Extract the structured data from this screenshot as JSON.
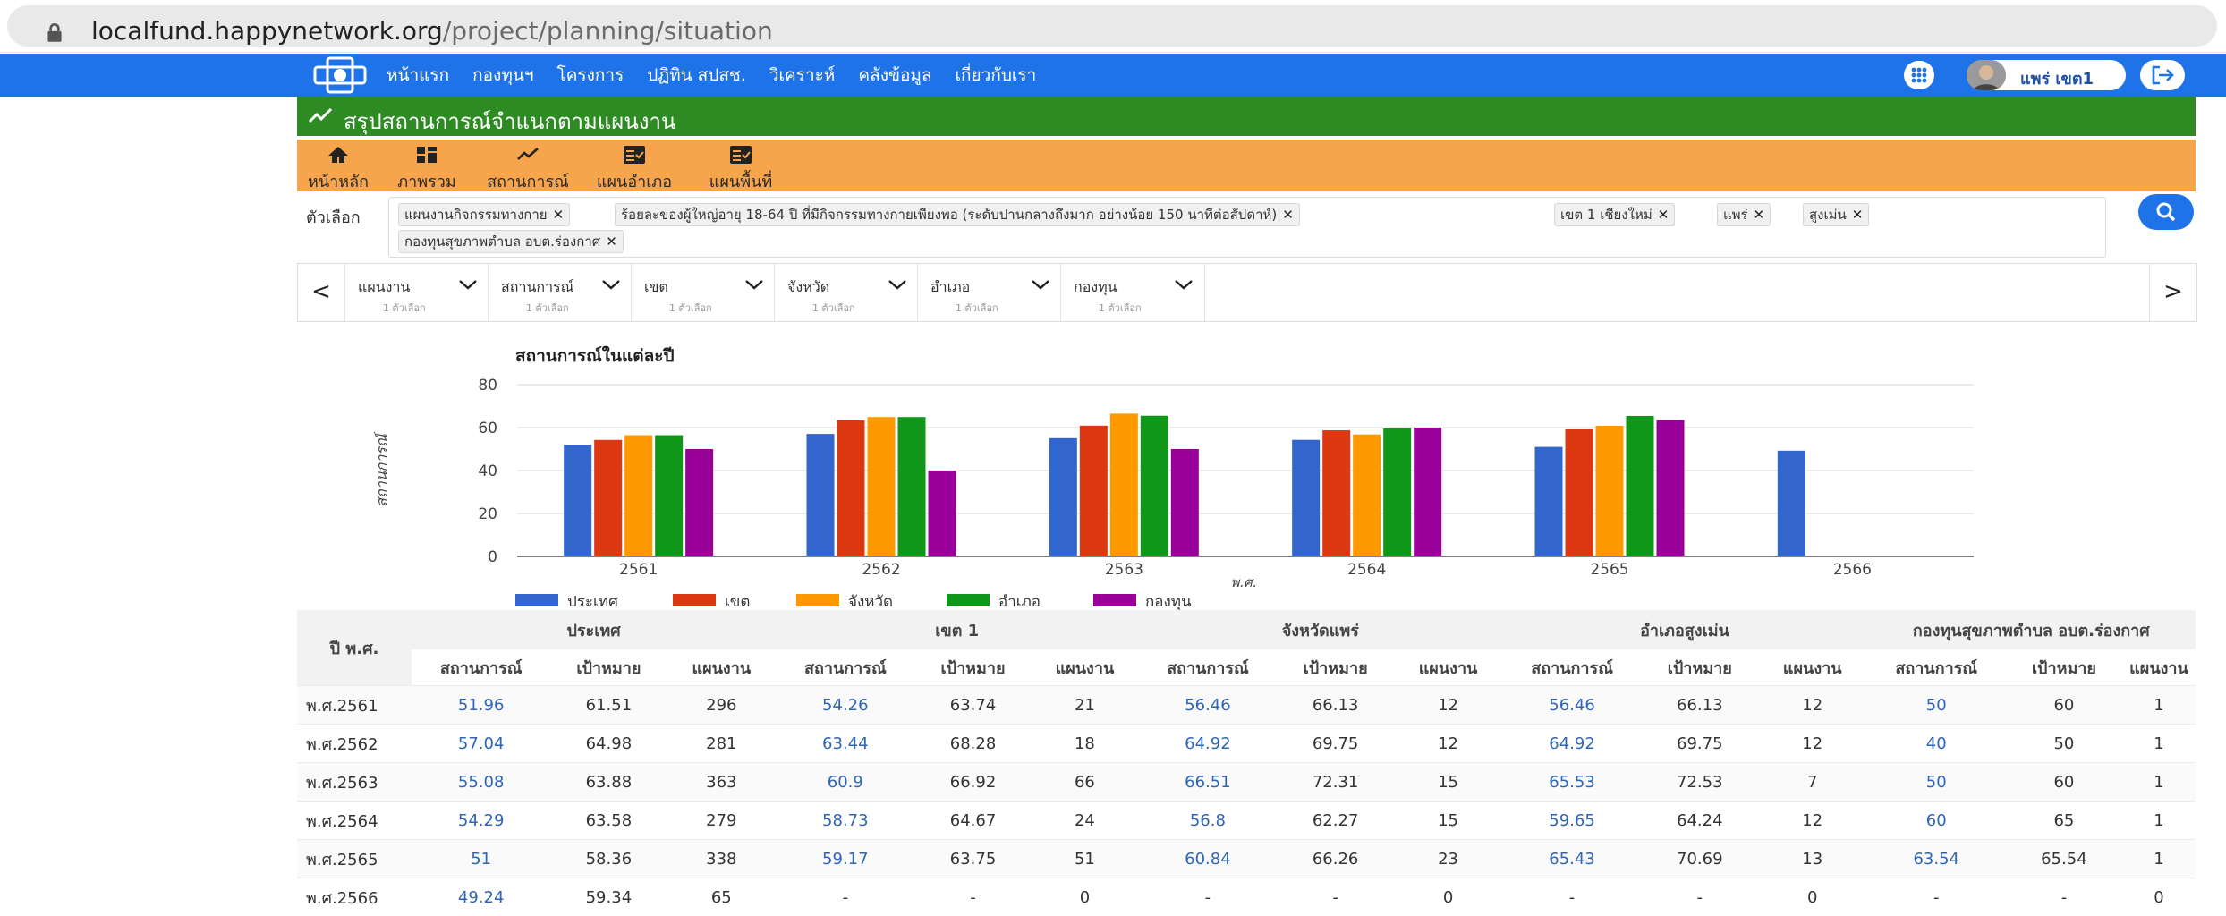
{
  "browser": {
    "url_domain": "localfund.happynetwork.org",
    "url_path": "/project/planning/situation"
  },
  "nav": {
    "items": [
      "หน้าแรก",
      "กองทุนฯ",
      "โครงการ",
      "ปฏิทิน สปสช.",
      "วิเคราะห์",
      "คลังข้อมูล",
      "เกี่ยวกับเรา"
    ],
    "user_name": "แพร่ เขต1"
  },
  "page": {
    "title": "สรุปสถานการณ์จำแนกตามแผนงาน"
  },
  "toolbar": {
    "buttons": [
      "หน้าหลัก",
      "ภาพรวม",
      "สถานการณ์",
      "แผนอำเภอ",
      "แผนพื้นที่"
    ]
  },
  "filters": {
    "label": "ตัวเลือก",
    "chips": [
      "แผนงานกิจกรรมทางกาย",
      "ร้อยละของผู้ใหญ่อายุ 18-64 ปี ที่มีกิจกรรมทางกายเพียงพอ (ระดับปานกลางถึงมาก อย่างน้อย 150 นาทีต่อสัปดาห์)",
      "เขต 1 เชียงใหม่",
      "แพร่",
      "สูงเม่น",
      "กองทุนสุขภาพตำบล อบต.ร่องกาศ"
    ]
  },
  "selectors": {
    "prev": "<",
    "next": ">",
    "items": [
      {
        "name": "แผนงาน",
        "sub": "1 ตัวเลือก"
      },
      {
        "name": "สถานการณ์",
        "sub": "1 ตัวเลือก"
      },
      {
        "name": "เขต",
        "sub": "1 ตัวเลือก"
      },
      {
        "name": "จังหวัด",
        "sub": "1 ตัวเลือก"
      },
      {
        "name": "อำเภอ",
        "sub": "1 ตัวเลือก"
      },
      {
        "name": "กองทุน",
        "sub": "1 ตัวเลือก"
      }
    ]
  },
  "chart_data": {
    "type": "bar",
    "title": "สถานการณ์ในแต่ละปี",
    "xlabel": "พ.ศ.",
    "ylabel": "สถานการณ์",
    "ylim": [
      0,
      80
    ],
    "yticks": [
      0,
      20,
      40,
      60,
      80
    ],
    "grid": true,
    "legend": "bottom-left",
    "categories": [
      "2561",
      "2562",
      "2563",
      "2564",
      "2565",
      "2566"
    ],
    "series": [
      {
        "name": "ประเทศ",
        "color": "#3366cc",
        "values": [
          51.96,
          57.04,
          55.08,
          54.29,
          51,
          49.24
        ]
      },
      {
        "name": "เขต",
        "color": "#dc3912",
        "values": [
          54.26,
          63.44,
          60.9,
          58.73,
          59.17,
          null
        ]
      },
      {
        "name": "จังหวัด",
        "color": "#ff9900",
        "values": [
          56.46,
          64.92,
          66.51,
          56.8,
          60.84,
          null
        ]
      },
      {
        "name": "อำเภอ",
        "color": "#109618",
        "values": [
          56.46,
          64.92,
          65.53,
          59.65,
          65.43,
          null
        ]
      },
      {
        "name": "กองทุน",
        "color": "#990099",
        "values": [
          50,
          40,
          50,
          60,
          63.54,
          null
        ]
      }
    ]
  },
  "table": {
    "year_header": "ปี พ.ศ.",
    "groups": [
      "ประเทศ",
      "เขต 1",
      "จังหวัดแพร่",
      "อำเภอสูงเม่น",
      "กองทุนสุขภาพตำบล อบต.ร่องกาศ"
    ],
    "subheaders": [
      "สถานการณ์",
      "เป้าหมาย",
      "แผนงาน"
    ],
    "rows": [
      {
        "year": "พ.ศ.2561",
        "cells": [
          "51.96",
          "61.51",
          "296",
          "54.26",
          "63.74",
          "21",
          "56.46",
          "66.13",
          "12",
          "56.46",
          "66.13",
          "12",
          "50",
          "60",
          "1"
        ]
      },
      {
        "year": "พ.ศ.2562",
        "cells": [
          "57.04",
          "64.98",
          "281",
          "63.44",
          "68.28",
          "18",
          "64.92",
          "69.75",
          "12",
          "64.92",
          "69.75",
          "12",
          "40",
          "50",
          "1"
        ]
      },
      {
        "year": "พ.ศ.2563",
        "cells": [
          "55.08",
          "63.88",
          "363",
          "60.9",
          "66.92",
          "66",
          "66.51",
          "72.31",
          "15",
          "65.53",
          "72.53",
          "7",
          "50",
          "60",
          "1"
        ]
      },
      {
        "year": "พ.ศ.2564",
        "cells": [
          "54.29",
          "63.58",
          "279",
          "58.73",
          "64.67",
          "24",
          "56.8",
          "62.27",
          "15",
          "59.65",
          "64.24",
          "12",
          "60",
          "65",
          "1"
        ]
      },
      {
        "year": "พ.ศ.2565",
        "cells": [
          "51",
          "58.36",
          "338",
          "59.17",
          "63.75",
          "51",
          "60.84",
          "66.26",
          "23",
          "65.43",
          "70.69",
          "13",
          "63.54",
          "65.54",
          "1"
        ]
      },
      {
        "year": "พ.ศ.2566",
        "cells": [
          "49.24",
          "59.34",
          "65",
          "-",
          "-",
          "0",
          "-",
          "-",
          "0",
          "-",
          "-",
          "0",
          "-",
          "-",
          "0"
        ]
      }
    ]
  }
}
